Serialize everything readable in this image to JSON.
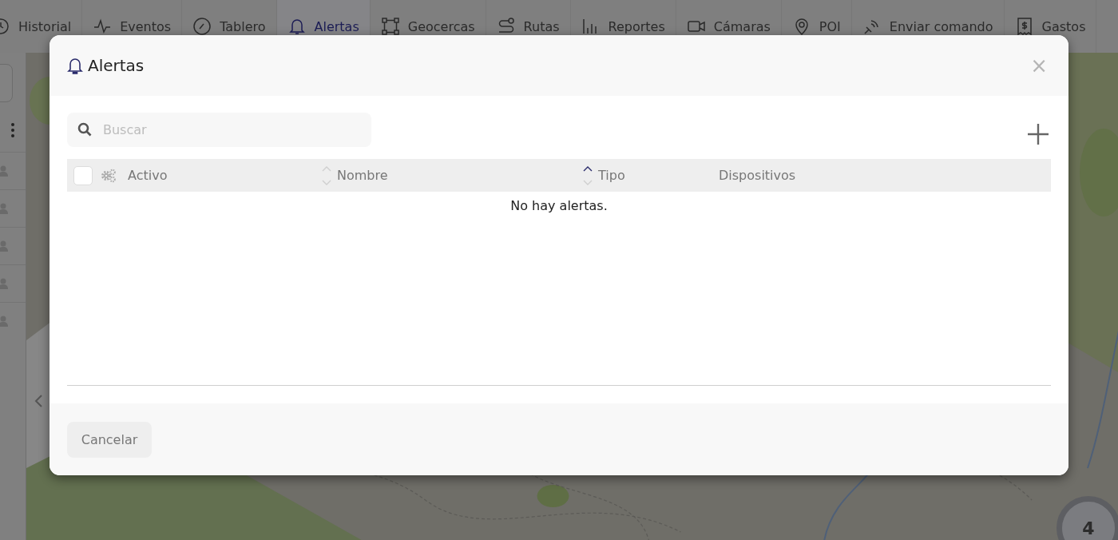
{
  "nav": {
    "items": [
      {
        "label": "Historial",
        "selected": false
      },
      {
        "label": "Eventos",
        "selected": false
      },
      {
        "label": "Tablero",
        "selected": false
      },
      {
        "label": "Alertas",
        "selected": true
      },
      {
        "label": "Geocercas",
        "selected": false
      },
      {
        "label": "Rutas",
        "selected": false
      },
      {
        "label": "Reportes",
        "selected": false
      },
      {
        "label": "Cámaras",
        "selected": false
      },
      {
        "label": "POI",
        "selected": false
      },
      {
        "label": "Enviar comando",
        "selected": false
      },
      {
        "label": "Gastos",
        "selected": false
      }
    ]
  },
  "map": {
    "kind": "picture",
    "cluster": {
      "count": "4"
    }
  },
  "modal": {
    "title": "Alertas",
    "close": "×",
    "search": {
      "placeholder": "Buscar"
    },
    "table": {
      "select_all": {
        "checked": false
      },
      "columns": [
        {
          "label": "Activo"
        },
        {
          "label": "Nombre",
          "sorted": false
        },
        {
          "label": "Tipo",
          "sorted": true
        },
        {
          "label": "Dispositivos"
        }
      ],
      "empty_message": "No hay alertas."
    },
    "buttons": [
      {
        "label": "Cancelar"
      }
    ]
  }
}
